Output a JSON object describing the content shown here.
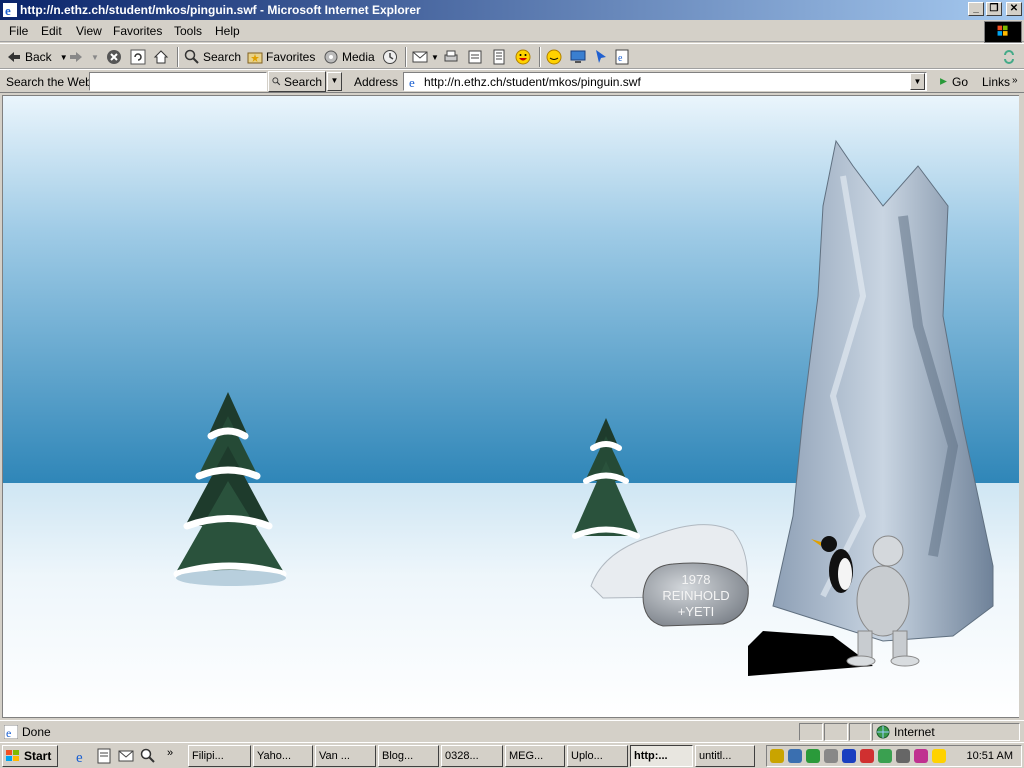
{
  "window": {
    "title": "http://n.ethz.ch/student/mkos/pinguin.swf - Microsoft Internet Explorer",
    "controls": [
      "_",
      "❐",
      "✕"
    ]
  },
  "menu": [
    "File",
    "Edit",
    "View",
    "Favorites",
    "Tools",
    "Help"
  ],
  "toolbar": {
    "back_label": "Back",
    "search_label": "Search",
    "favorites_label": "Favorites",
    "media_label": "Media"
  },
  "searchbar": {
    "label": "Search the Web",
    "value": "",
    "button_label": "Search"
  },
  "address": {
    "label": "Address",
    "url": "http://n.ethz.ch/student/mkos/pinguin.swf",
    "go_label": "Go",
    "links_label": "Links"
  },
  "scene": {
    "rock_text": [
      "1978",
      "REINHOLD",
      "+YETI"
    ]
  },
  "status": {
    "text": "Done",
    "zone": "Internet"
  },
  "taskbar": {
    "start_label": "Start",
    "tasks": [
      "Filipi...",
      "Yaho...",
      "Van ...",
      "Blog...",
      "0328...",
      "MEG...",
      "Uplo...",
      "http:...",
      "untitl..."
    ],
    "active_task_index": 7,
    "clock": "10:51 AM"
  },
  "colors": {
    "title_start": "#0a246a",
    "title_end": "#a6caf0",
    "chrome": "#d4d0c8",
    "sky_top": "#e8f3fb",
    "sky_bottom": "#2f86b8"
  }
}
